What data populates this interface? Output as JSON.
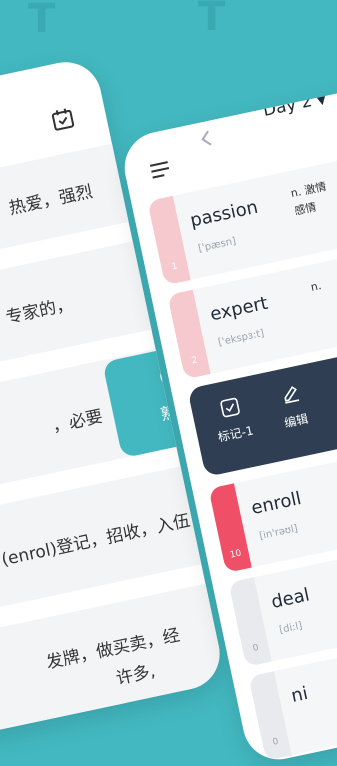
{
  "left_card": {
    "calendar_icon": "calendar-check-icon",
    "items": [
      {
        "text": "热爱，强烈"
      },
      {
        "text": "行家；a. 专家的，"
      },
      {
        "text": "，必要"
      },
      {
        "text": "v. (enrol)登记，招收，入伍"
      },
      {
        "text": "发牌，做买卖，经"
      },
      {
        "text": "许多,"
      }
    ],
    "swipe_action": {
      "label": "熟知",
      "icon": "check-circle-icon"
    }
  },
  "right_card": {
    "day_label": "Day 2",
    "menu_icon": "menu-icon",
    "back_icon": "chevron-left-icon",
    "dropdown_icon": "caret-down-icon",
    "words": [
      {
        "word": "passion",
        "phonetic": "['pæsn]",
        "meaning": "n. 激情\n感情",
        "count": "1",
        "level_color": "#f6c9cf"
      },
      {
        "word": "expert",
        "phonetic": "['ekspɜ:t]",
        "meaning": "n.",
        "count": "2",
        "level_color": "#f6c9cf"
      },
      {
        "word": "enroll",
        "phonetic": "[in'rəʊl]",
        "meaning": "",
        "count": "10",
        "level_color": "#ef4f67"
      },
      {
        "word": "deal",
        "phonetic": "[di:l]",
        "meaning": "",
        "count": "0",
        "level_color": "#e9eaee"
      },
      {
        "word": "ni",
        "phonetic": "",
        "meaning": "",
        "count": "0",
        "level_color": "#e9eaee"
      }
    ],
    "actions": [
      {
        "label": "标记-1",
        "icon": "check-square-icon"
      },
      {
        "label": "编辑",
        "icon": "edit-icon"
      }
    ]
  }
}
